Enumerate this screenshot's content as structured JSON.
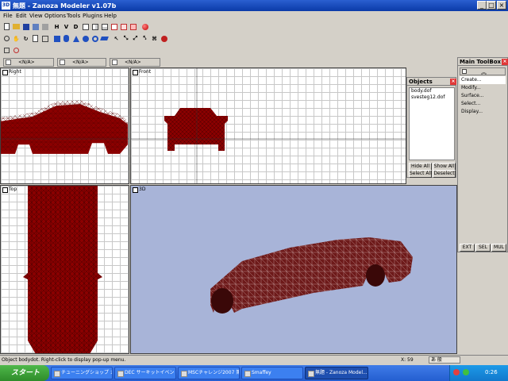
{
  "window": {
    "title": "無題 - Zanoza Modeler v1.07b",
    "app_icon": "3D"
  },
  "menu": [
    "File",
    "Edit",
    "View",
    "Options",
    "Tools",
    "Plugins",
    "Help"
  ],
  "toolbar1": {
    "letters": [
      "H",
      "V",
      "D"
    ]
  },
  "selection_bar": [
    "<N/A>",
    "<N/A>",
    "<N/A>"
  ],
  "viewports": {
    "right": "Right",
    "front": "Front",
    "top": "Top",
    "three_d": "3D"
  },
  "objects_panel": {
    "title": "Objects",
    "items": [
      "body.dof",
      "svesteg12.dof"
    ],
    "buttons": [
      "Hide All",
      "Show All",
      "Select All",
      "Deselect"
    ]
  },
  "toolbox": {
    "title": "Main ToolBox",
    "items": [
      "Create...",
      "Modify...",
      "Surface...",
      "Select...",
      "Display..."
    ],
    "bottom_buttons": [
      "EXT",
      "SEL",
      "MUL"
    ]
  },
  "status": {
    "message": "Object bodydot. Right-click to display pop-up menu.",
    "coord": "X: 59"
  },
  "taskbar": {
    "start": "スタート",
    "tasks": [
      "チューニングショップ カ...",
      "DEC サーキットイベント...",
      "MSCチャレンジ2007 第...",
      "Smaffey",
      "無題 - Zanoza Model..."
    ],
    "clock": "0:26",
    "ime": "あ 般"
  },
  "colors": {
    "titlebar": "#0a3aa8",
    "mesh": "#8b0000",
    "viewport_3d_bg": "#a8b4d8"
  }
}
